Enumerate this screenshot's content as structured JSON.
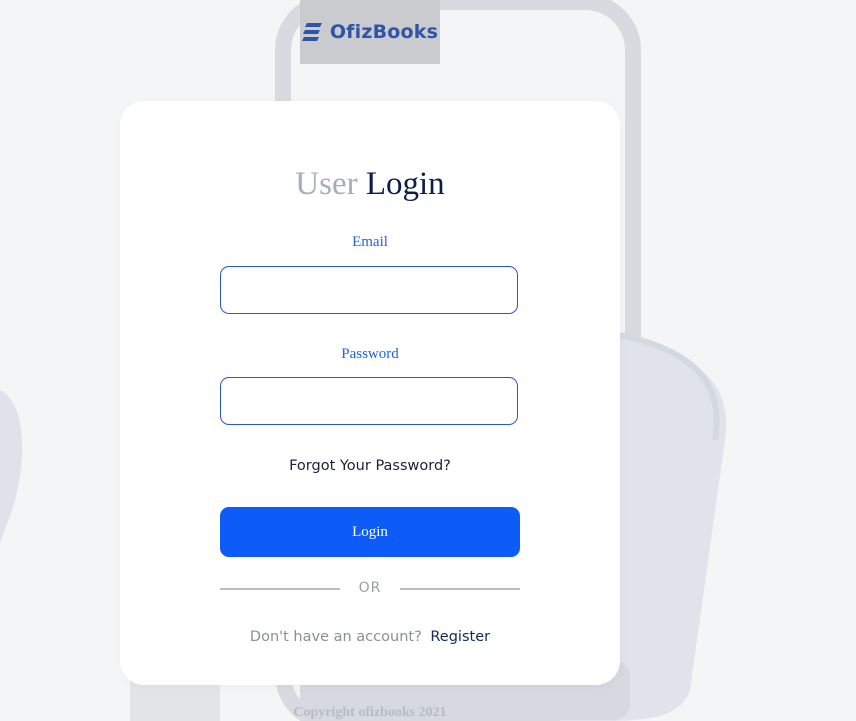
{
  "brand": {
    "name": "OfizBooks",
    "icon": "stacked-books-logo-mark"
  },
  "login_form": {
    "title_light": "User",
    "title_dark": "Login",
    "email_label": "Email",
    "email_value": "",
    "password_label": "Password",
    "password_value": "",
    "forgot_password": "Forgot Your Password?",
    "submit_label": "Login",
    "divider_text": "OR",
    "register_prompt": "Don't have an account?",
    "register_link": "Register"
  },
  "footer": {
    "copyright": "Copyright ofizbooks 2021"
  },
  "colors": {
    "accent": "#0d5cf7",
    "label": "#1e63e6",
    "title_dark": "#0b1e4a",
    "title_light": "#a7adbb",
    "background": "#f4f5f6"
  }
}
